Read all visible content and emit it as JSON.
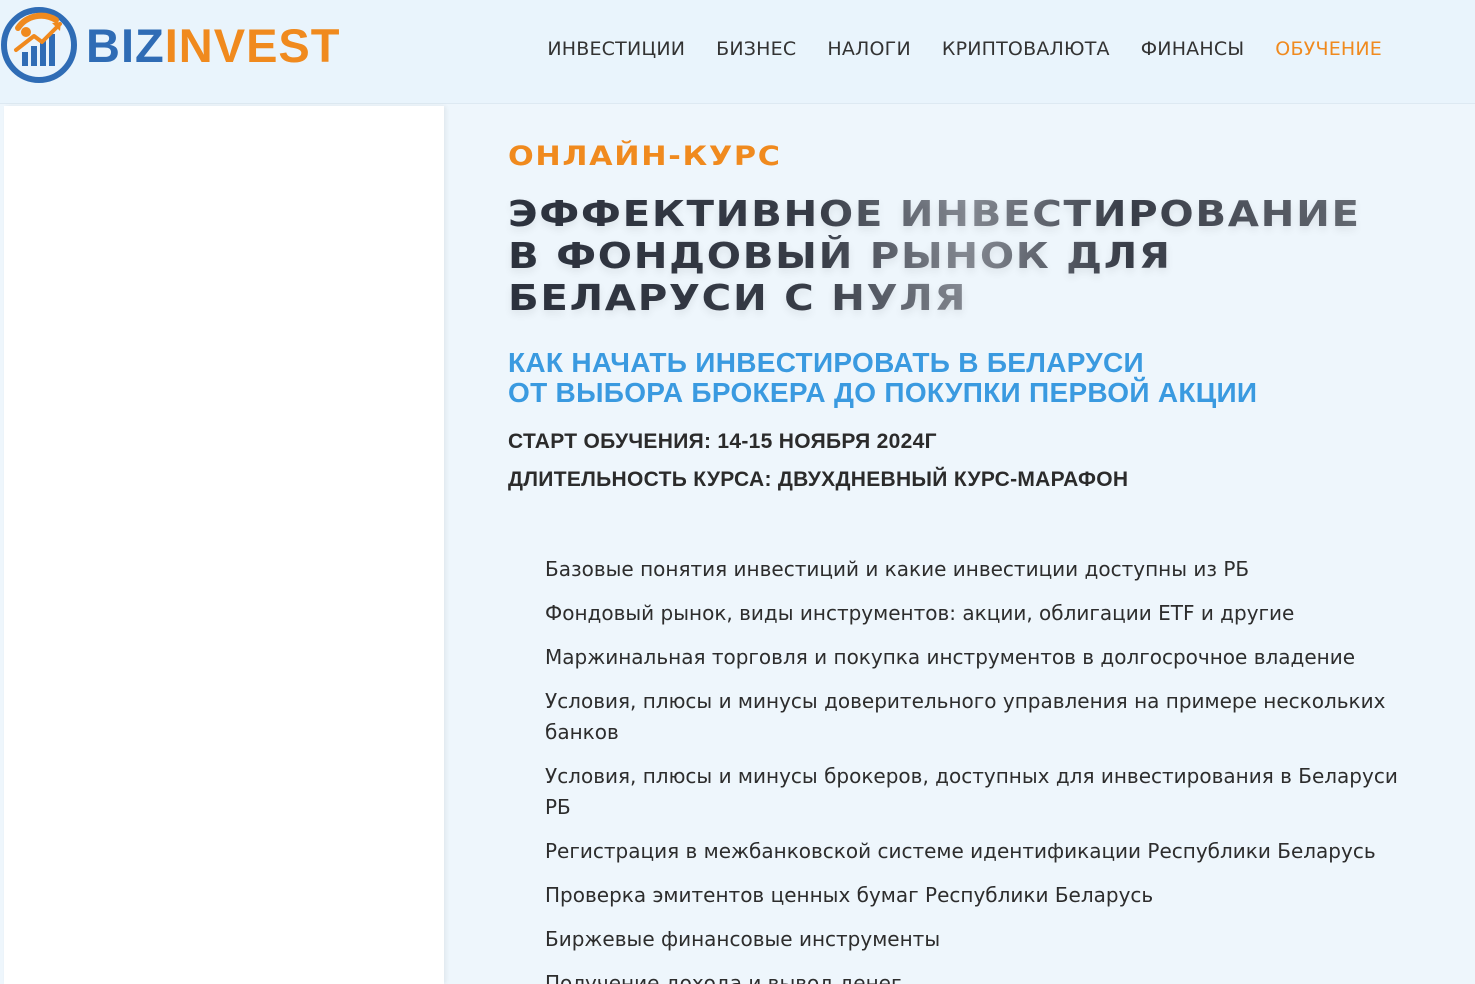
{
  "header": {
    "logo": {
      "part1": "BIZ",
      "part2": "INVEST"
    },
    "nav": [
      {
        "label": "ИНВЕСТИЦИИ",
        "active": false
      },
      {
        "label": "БИЗНЕС",
        "active": false
      },
      {
        "label": "НАЛОГИ",
        "active": false
      },
      {
        "label": "КРИПТОВАЛЮТА",
        "active": false
      },
      {
        "label": "ФИНАНСЫ",
        "active": false
      },
      {
        "label": "ОБУЧЕНИЕ",
        "active": true
      }
    ]
  },
  "course": {
    "eyebrow": "ОНЛАЙН-КУРС",
    "title": "ЭФФЕКТИВНОЕ ИНВЕСТИРОВАНИЕ В ФОНДОВЫЙ РЫНОК ДЛЯ БЕЛАРУСИ С НУЛЯ",
    "subtitle_line1": "КАК НАЧАТЬ ИНВЕСТИРОВАТЬ В БЕЛАРУСИ",
    "subtitle_line2": "ОТ ВЫБОРА БРОКЕРА ДО ПОКУПКИ ПЕРВОЙ АКЦИИ",
    "start": "СТАРТ ОБУЧЕНИЯ: 14-15 НОЯБРЯ 2024Г",
    "duration": "ДЛИТЕЛЬНОСТЬ КУРСА: ДВУХДНЕВНЫЙ КУРС-МАРАФОН",
    "topics": [
      "Базовые понятия инвестиций и какие инвестиции доступны из РБ",
      "Фондовый рынок, виды инструментов: акции, облигации ETF и другие",
      "Маржинальная торговля и покупка инструментов в долгосрочное владение",
      "Условия, плюсы и минусы доверительного управления на примере нескольких банков",
      "Условия, плюсы и минусы брокеров, доступных для инвестирования в Беларуси РБ",
      "Регистрация в межбанковской системе идентификации Республики Беларусь",
      "Проверка эмитентов ценных бумаг Республики Беларусь",
      "Биржевые финансовые инструменты",
      "Получение дохода и вывод денег"
    ]
  },
  "colors": {
    "accent_orange": "#f08a1e",
    "brand_blue": "#2f6cb5",
    "subtitle_blue": "#3a9ae0",
    "background": "#eef6fc"
  }
}
